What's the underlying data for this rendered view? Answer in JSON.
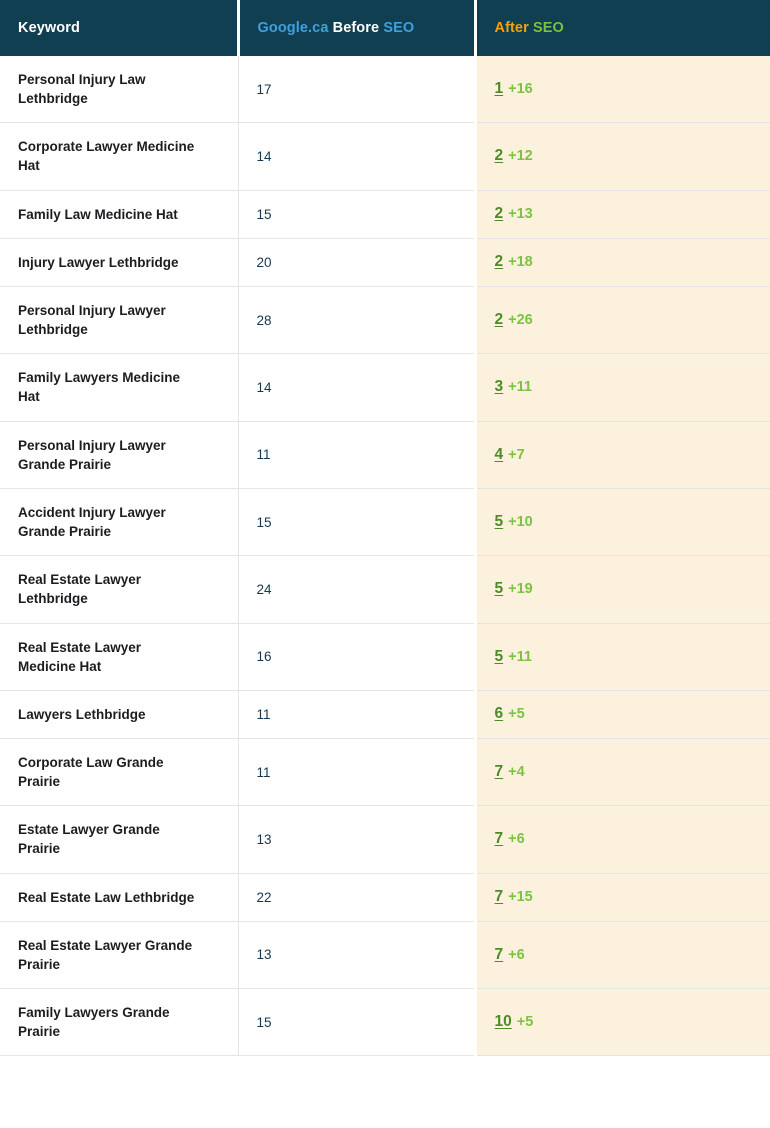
{
  "table": {
    "headers": {
      "keyword": "Keyword",
      "before": {
        "google": "Google.ca",
        "before": "Before",
        "seo": "SEO",
        "full": "Google.ca Before SEO"
      },
      "after": {
        "after": "After",
        "seo": "SEO",
        "full": "After SEO"
      }
    },
    "colors": {
      "header_bg": "#103F52",
      "header_text": "#ffffff",
      "google_blue": "#3FA0DE",
      "after_orange": "#F2A20C",
      "seo_green": "#7DBF3F",
      "after_column_bg": "#FCF1DC",
      "rank_green": "#4C8B28",
      "delta_green": "#7DC242",
      "keyword_text": "#1B1D21",
      "before_text": "#17374E",
      "row_border": "#E4E6E6"
    },
    "rows": [
      {
        "keyword": "Personal Injury Law Lethbridge",
        "before": "17",
        "after": "1",
        "delta": "+16"
      },
      {
        "keyword": "Corporate Lawyer Medicine Hat",
        "before": "14",
        "after": "2",
        "delta": "+12"
      },
      {
        "keyword": "Family Law Medicine Hat",
        "before": "15",
        "after": "2",
        "delta": "+13"
      },
      {
        "keyword": "Injury Lawyer Lethbridge",
        "before": "20",
        "after": "2",
        "delta": "+18"
      },
      {
        "keyword": "Personal Injury Lawyer Lethbridge",
        "before": "28",
        "after": "2",
        "delta": "+26"
      },
      {
        "keyword": "Family Lawyers Medicine Hat",
        "before": "14",
        "after": "3",
        "delta": "+11"
      },
      {
        "keyword": "Personal Injury Lawyer Grande Prairie",
        "before": "11",
        "after": "4",
        "delta": "+7"
      },
      {
        "keyword": "Accident Injury Lawyer Grande Prairie",
        "before": "15",
        "after": "5",
        "delta": "+10"
      },
      {
        "keyword": "Real Estate Lawyer Lethbridge",
        "before": "24",
        "after": "5",
        "delta": "+19"
      },
      {
        "keyword": "Real Estate Lawyer Medicine Hat",
        "before": "16",
        "after": "5",
        "delta": "+11"
      },
      {
        "keyword": "Lawyers Lethbridge",
        "before": "11",
        "after": "6",
        "delta": "+5"
      },
      {
        "keyword": "Corporate Law Grande Prairie",
        "before": "11",
        "after": "7",
        "delta": "+4"
      },
      {
        "keyword": "Estate Lawyer Grande Prairie",
        "before": "13",
        "after": "7",
        "delta": "+6"
      },
      {
        "keyword": "Real Estate Law Lethbridge",
        "before": "22",
        "after": "7",
        "delta": "+15"
      },
      {
        "keyword": "Real Estate Lawyer Grande Prairie",
        "before": "13",
        "after": "7",
        "delta": "+6"
      },
      {
        "keyword": "Family Lawyers Grande Prairie",
        "before": "15",
        "after": "10",
        "delta": "+5"
      }
    ]
  }
}
